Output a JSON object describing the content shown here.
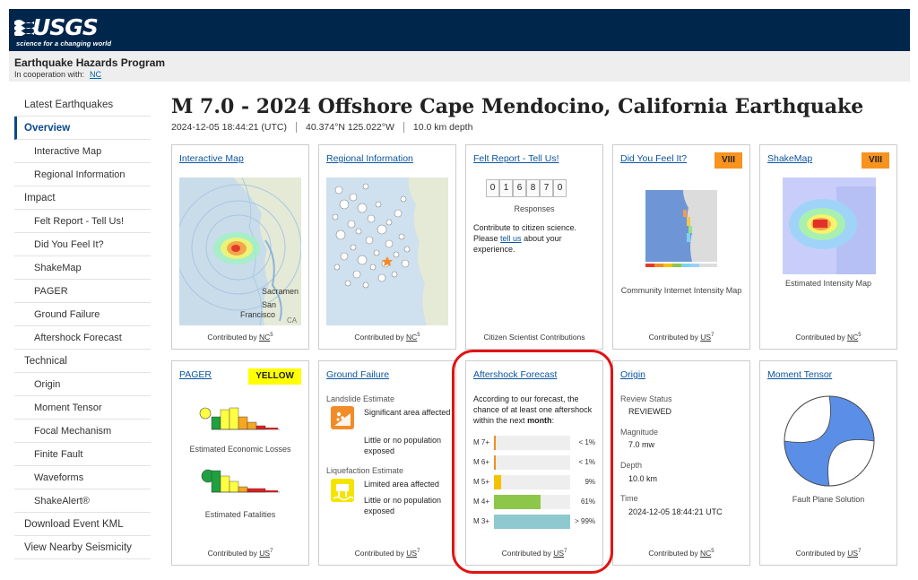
{
  "header": {
    "logo_text": "USGS",
    "tagline": "science for a changing world",
    "program_name": "Earthquake Hazards Program",
    "coop_label": "In cooperation with:",
    "coop_link": "NC"
  },
  "sidebar": {
    "items": [
      {
        "label": "Latest Earthquakes",
        "level": "top"
      },
      {
        "label": "Overview",
        "level": "top",
        "active": true
      },
      {
        "label": "Interactive Map",
        "level": "sub"
      },
      {
        "label": "Regional Information",
        "level": "sub"
      },
      {
        "label": "Impact",
        "level": "top"
      },
      {
        "label": "Felt Report - Tell Us!",
        "level": "sub"
      },
      {
        "label": "Did You Feel It?",
        "level": "sub"
      },
      {
        "label": "ShakeMap",
        "level": "sub"
      },
      {
        "label": "PAGER",
        "level": "sub"
      },
      {
        "label": "Ground Failure",
        "level": "sub"
      },
      {
        "label": "Aftershock Forecast",
        "level": "sub"
      },
      {
        "label": "Technical",
        "level": "top"
      },
      {
        "label": "Origin",
        "level": "sub"
      },
      {
        "label": "Moment Tensor",
        "level": "sub"
      },
      {
        "label": "Focal Mechanism",
        "level": "sub"
      },
      {
        "label": "Finite Fault",
        "level": "sub"
      },
      {
        "label": "Waveforms",
        "level": "sub"
      },
      {
        "label": "ShakeAlert®",
        "level": "sub"
      },
      {
        "label": "Download Event KML",
        "level": "top"
      },
      {
        "label": "View Nearby Seismicity",
        "level": "top"
      }
    ]
  },
  "event": {
    "title": "M 7.0 - 2024 Offshore Cape Mendocino, California Earthquake",
    "time": "2024-12-05 18:44:21 (UTC)",
    "location": "40.374°N 125.022°W",
    "depth": "10.0 km depth"
  },
  "cards": {
    "interactive_map": {
      "title": "Interactive Map",
      "map_labels": {
        "sacramento": "Sacramen",
        "san": "San",
        "francisco": "Francisco",
        "ca": "CA"
      },
      "footer_prefix": "Contributed by",
      "contributor": "NC",
      "sup": "5"
    },
    "regional_info": {
      "title": "Regional Information",
      "footer_prefix": "Contributed by",
      "contributor": "NC",
      "sup": "5"
    },
    "felt_report": {
      "title": "Felt Report - Tell Us!",
      "digits": [
        "0",
        "1",
        "6",
        "8",
        "7",
        "0"
      ],
      "responses_label": "Responses",
      "text_before": "Contribute to citizen science. Please",
      "link": "tell us",
      "text_after": "about your experience.",
      "footer": "Citizen Scientist Contributions"
    },
    "dyfi": {
      "title": "Did You Feel It?",
      "badge": "VIII",
      "badge_color": "#f7931e",
      "caption": "Community Internet Intensity Map",
      "footer_prefix": "Contributed by",
      "contributor": "US",
      "sup": "7"
    },
    "shakemap": {
      "title": "ShakeMap",
      "badge": "VIII",
      "badge_color": "#f7931e",
      "caption": "Estimated Intensity Map",
      "footer_prefix": "Contributed by",
      "contributor": "NC",
      "sup": "5"
    },
    "pager": {
      "title": "PAGER",
      "badge": "YELLOW",
      "badge_color": "#ffff00",
      "caption_losses": "Estimated Economic Losses",
      "caption_fatalities": "Estimated Fatalities",
      "footer_prefix": "Contributed by",
      "contributor": "US",
      "sup": "7"
    },
    "ground_failure": {
      "title": "Ground Failure",
      "landslide_heading": "Landslide Estimate",
      "landslide_area": "Significant area affected",
      "landslide_pop": "Little or no population exposed",
      "liquefaction_heading": "Liquefaction Estimate",
      "liquefaction_area": "Limited area affected",
      "liquefaction_pop": "Little or no population exposed",
      "footer_prefix": "Contributed by",
      "contributor": "US",
      "sup": "7"
    },
    "aftershock": {
      "title": "Aftershock Forecast",
      "intro": "According to our forecast, the chance of at least one aftershock within the next",
      "intro_bold": "month",
      "intro_end": ":",
      "rows": [
        {
          "mag": "M 7+",
          "label": "< 1%",
          "value": 0.01,
          "color": "#f28c28"
        },
        {
          "mag": "M 6+",
          "label": "< 1%",
          "value": 0.01,
          "color": "#f28c28"
        },
        {
          "mag": "M 5+",
          "label": "9%",
          "value": 0.09,
          "color": "#f5c200"
        },
        {
          "mag": "M 4+",
          "label": "61%",
          "value": 0.61,
          "color": "#8dc74a"
        },
        {
          "mag": "M 3+",
          "label": "> 99%",
          "value": 0.995,
          "color": "#8ec9d0"
        }
      ],
      "footer_prefix": "Contributed by",
      "contributor": "US",
      "sup": "7"
    },
    "origin": {
      "title": "Origin",
      "review_label": "Review Status",
      "review_value": "REVIEWED",
      "magnitude_label": "Magnitude",
      "magnitude_value": "7.0 mw",
      "depth_label": "Depth",
      "depth_value": "10.0 km",
      "time_label": "Time",
      "time_value": "2024-12-05 18:44:21 UTC",
      "footer_prefix": "Contributed by",
      "contributor": "NC",
      "sup": "5"
    },
    "moment_tensor": {
      "title": "Moment Tensor",
      "caption": "Fault Plane Solution",
      "footer_prefix": "Contributed by",
      "contributor": "US",
      "sup": "7"
    }
  }
}
